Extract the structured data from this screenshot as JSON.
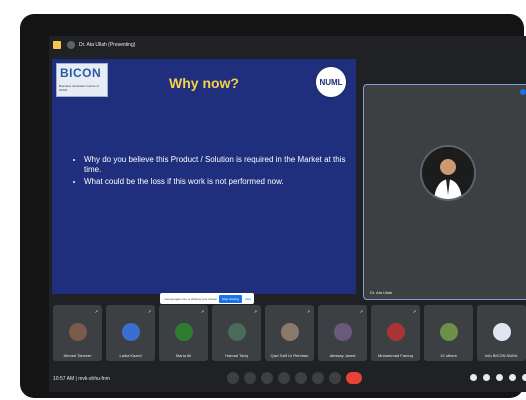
{
  "header": {
    "title": "Dr. Ata Ullah (Presenting)"
  },
  "slide": {
    "logo_text": "BICON",
    "logo_sub": "Business Incubation Centre of NUML",
    "title": "Why now?",
    "seal_text": "NUML",
    "bullets": [
      "Why do you believe this Product / Solution is required in the Market at this time.",
      "What could be the loss if this work is not performed now."
    ],
    "share_bar": {
      "text": "meet.google.com is sharing your screen",
      "stop_label": "Stop sharing",
      "hide_label": "Hide"
    }
  },
  "speaker": {
    "name": "Dr. Ata Ullah"
  },
  "participants": [
    {
      "name": "Ahmed Tanveer"
    },
    {
      "name": "Laiba Kazmi"
    },
    {
      "name": "Maria Ali"
    },
    {
      "name": "Hamad Tariq"
    },
    {
      "name": "Qazi Saif Ur Rehman"
    },
    {
      "name": "Alessay Javed"
    },
    {
      "name": "Muhammad Farooq"
    },
    {
      "name": "10 others"
    },
    {
      "name": "Info BICON NUML"
    }
  ],
  "footer": {
    "time": "10:57 AM | mvk-shhu-fnm"
  },
  "colors": {
    "accent": "#1a73e8",
    "end_call": "#ea4335",
    "slide_bg": "#1f2f7d",
    "slide_title": "#f5d24a"
  }
}
